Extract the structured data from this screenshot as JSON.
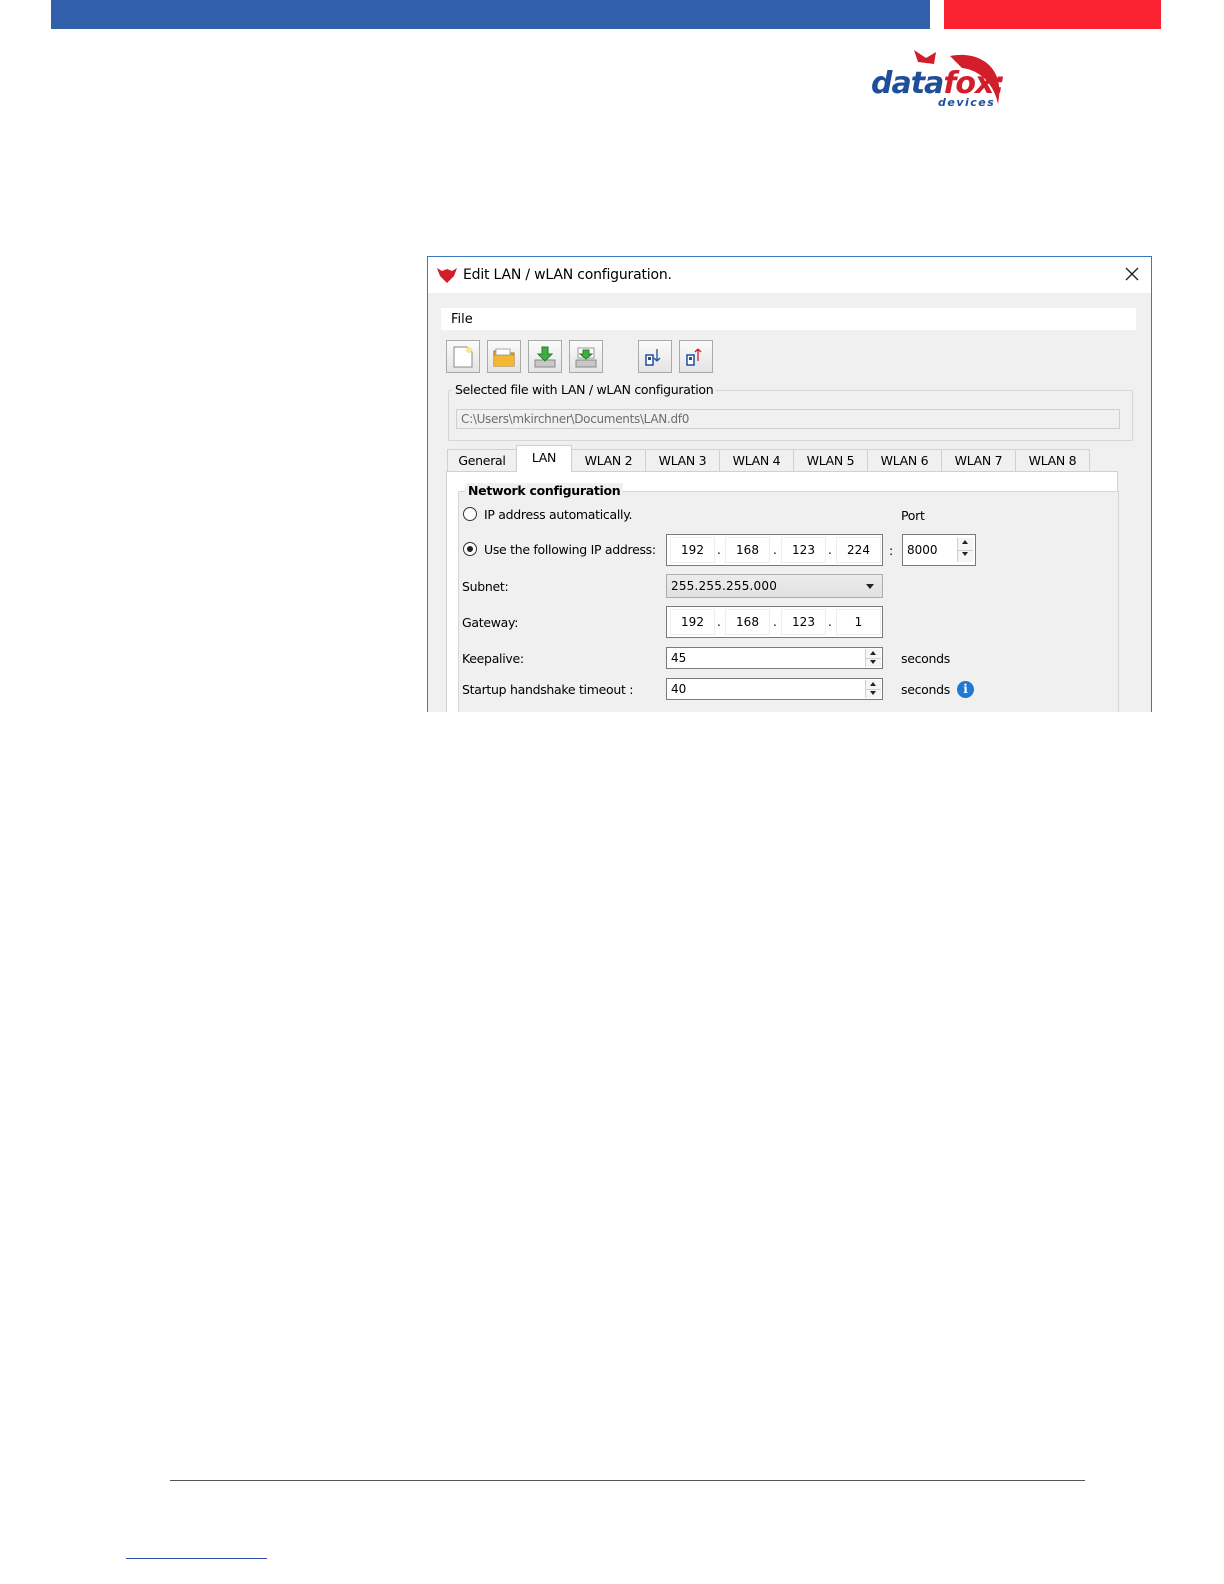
{
  "brand": {
    "logo_word_part1": "data",
    "logo_word_part2": "fox:",
    "logo_sub": "devices",
    "color_blue": "#3360ab",
    "color_red": "#fb2332"
  },
  "dialog": {
    "title": "Edit LAN / wLAN configuration.",
    "menu": {
      "file": "File"
    },
    "toolbar": [
      {
        "icon": "new-file-icon"
      },
      {
        "icon": "open-folder-icon"
      },
      {
        "icon": "save-download-icon"
      },
      {
        "icon": "save-as-icon"
      },
      {
        "icon": "read-from-device-icon"
      },
      {
        "icon": "write-to-device-icon"
      }
    ],
    "file_group": {
      "legend": "Selected file with LAN / wLAN configuration",
      "path": "C:\\Users\\mkirchner\\Documents\\LAN.df0"
    },
    "tabs": [
      "General",
      "LAN",
      "WLAN 2",
      "WLAN 3",
      "WLAN 4",
      "WLAN 5",
      "WLAN 6",
      "WLAN 7",
      "WLAN 8"
    ],
    "active_tab": "LAN",
    "network": {
      "legend": "Network configuration",
      "auto_ip_label": "IP address automatically.",
      "manual_ip_label": "Use the following IP address:",
      "ip": [
        "192",
        "168",
        "123",
        "224"
      ],
      "port_label": "Port",
      "port_sep": ":",
      "port": "8000",
      "subnet_label": "Subnet:",
      "subnet": "255.255.255.000",
      "gateway_label": "Gateway:",
      "gateway": [
        "192",
        "168",
        "123",
        "1"
      ],
      "keepalive_label": "Keepalive:",
      "keepalive": "45",
      "keepalive_unit": "seconds",
      "startup_label": "Startup handshake timeout :",
      "startup": "40",
      "startup_unit": "seconds",
      "info_glyph": "i"
    }
  }
}
